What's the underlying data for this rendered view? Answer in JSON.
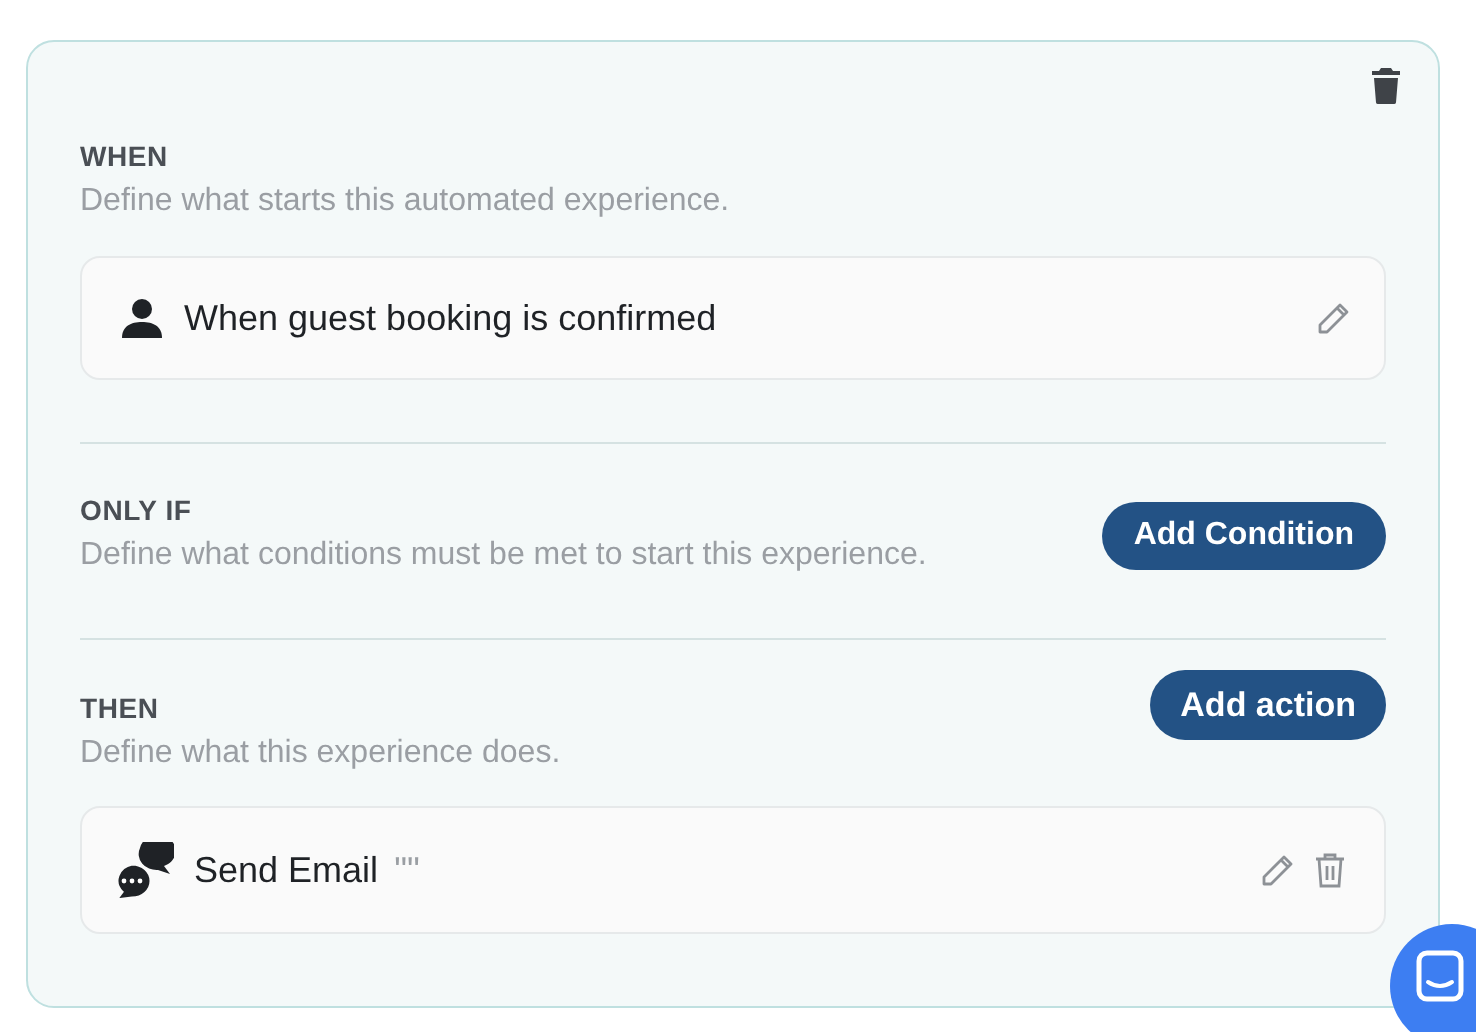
{
  "when": {
    "title": "WHEN",
    "description": "Define what starts this automated experience.",
    "trigger": {
      "label": "When guest booking is confirmed"
    }
  },
  "only_if": {
    "title": "ONLY IF",
    "description": "Define what conditions must be met to start this experience.",
    "button": "Add Condition"
  },
  "then": {
    "title": "THEN",
    "description": "Define what this experience does.",
    "button": "Add action",
    "actions": [
      {
        "label": "Send Email",
        "detail": "\"\""
      }
    ]
  }
}
